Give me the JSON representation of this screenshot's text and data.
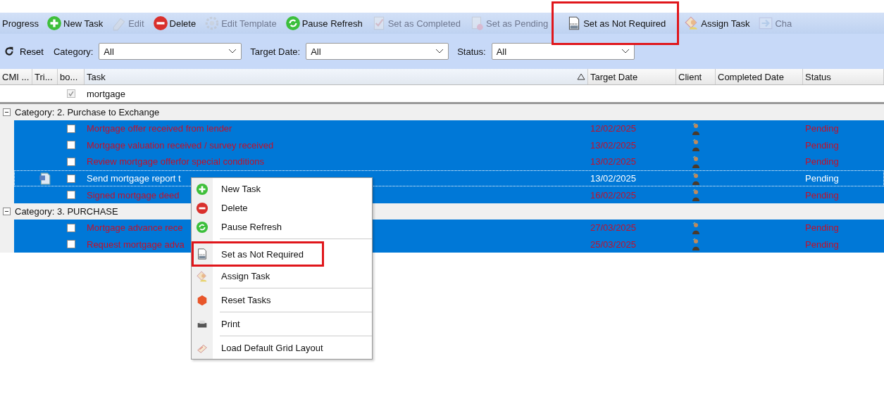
{
  "toolbar": {
    "title": "Progress",
    "items": [
      {
        "kind": "add",
        "label": "New Task",
        "disabled": false,
        "highlighted": false
      },
      {
        "kind": "edit",
        "label": "Edit",
        "disabled": true,
        "highlighted": false
      },
      {
        "kind": "delete",
        "label": "Delete",
        "disabled": false,
        "highlighted": false
      },
      {
        "kind": "template",
        "label": "Edit Template",
        "disabled": true,
        "highlighted": false
      },
      {
        "kind": "refresh",
        "label": "Pause Refresh",
        "disabled": false,
        "highlighted": false
      },
      {
        "kind": "complete",
        "label": "Set as Completed",
        "disabled": true,
        "highlighted": false
      },
      {
        "kind": "pending",
        "label": "Set as Pending",
        "disabled": true,
        "highlighted": false
      },
      {
        "kind": "not-required",
        "label": "Set as Not Required",
        "disabled": false,
        "highlighted": true
      },
      {
        "kind": "assign",
        "label": "Assign Task",
        "disabled": false,
        "highlighted": false
      },
      {
        "kind": "change",
        "label": "Cha",
        "disabled": true,
        "highlighted": false
      }
    ]
  },
  "filters": {
    "reset": "Reset",
    "fields": [
      {
        "label": "Category:",
        "value": "All"
      },
      {
        "label": "Target Date:",
        "value": "All"
      },
      {
        "label": "Status:",
        "value": "All"
      }
    ]
  },
  "table": {
    "columns": [
      {
        "label": "CMI ...",
        "sorted": false
      },
      {
        "label": "Tri...",
        "sorted": false
      },
      {
        "label": "bo...",
        "sorted": false
      },
      {
        "label": "Task",
        "sorted": true
      },
      {
        "label": "Target Date",
        "sorted": false
      },
      {
        "label": "Client",
        "sorted": false
      },
      {
        "label": "Completed Date",
        "sorted": false
      },
      {
        "label": "Status",
        "sorted": false
      }
    ],
    "filter_row": {
      "checked": true,
      "task": "mortgage"
    },
    "groups": [
      {
        "title": "Category: 2. Purchase to Exchange",
        "expanded": true,
        "rows": [
          {
            "task": "Mortgage offer received from lender",
            "target_date": "12/02/2025",
            "status": "Pending",
            "selected": true,
            "focused": false,
            "checked": false,
            "has_document": false
          },
          {
            "task": "Mortgage valuation received / survey received",
            "target_date": "13/02/2025",
            "status": "Pending",
            "selected": true,
            "focused": false,
            "checked": false,
            "has_document": false
          },
          {
            "task": "Review mortgage offerfor special conditions",
            "target_date": "13/02/2025",
            "status": "Pending",
            "selected": true,
            "focused": false,
            "checked": false,
            "has_document": false
          },
          {
            "task": "Send mortgage report t",
            "target_date": "13/02/2025",
            "status": "Pending",
            "selected": true,
            "focused": true,
            "checked": false,
            "has_document": true
          },
          {
            "task": "Signed mortgage deed",
            "target_date": "16/02/2025",
            "status": "Pending",
            "selected": true,
            "focused": false,
            "checked": false,
            "has_document": false
          }
        ]
      },
      {
        "title": "Category: 3. PURCHASE",
        "expanded": true,
        "rows": [
          {
            "task": "Mortgage advance rece",
            "target_date": "27/03/2025",
            "status": "Pending",
            "selected": true,
            "focused": false,
            "checked": false,
            "has_document": false
          },
          {
            "task": "Request mortgage adva",
            "target_date": "25/03/2025",
            "status": "Pending",
            "selected": true,
            "focused": false,
            "checked": false,
            "has_document": false
          }
        ]
      }
    ]
  },
  "context_menu": {
    "items": [
      {
        "kind": "add",
        "label": "New Task",
        "highlighted": false,
        "divider_after": false
      },
      {
        "kind": "delete",
        "label": "Delete",
        "highlighted": false,
        "divider_after": false
      },
      {
        "kind": "refresh",
        "label": "Pause Refresh",
        "highlighted": false,
        "divider_after": true
      },
      {
        "kind": "not-required",
        "label": "Set as Not Required",
        "highlighted": true,
        "divider_after": false
      },
      {
        "kind": "assign",
        "label": "Assign Task",
        "highlighted": false,
        "divider_after": true
      },
      {
        "kind": "reset",
        "label": "Reset Tasks",
        "highlighted": false,
        "divider_after": true
      },
      {
        "kind": "print",
        "label": "Print",
        "highlighted": false,
        "divider_after": true
      },
      {
        "kind": "layout",
        "label": "Load Default Grid Layout",
        "highlighted": false,
        "divider_after": false
      }
    ]
  }
}
